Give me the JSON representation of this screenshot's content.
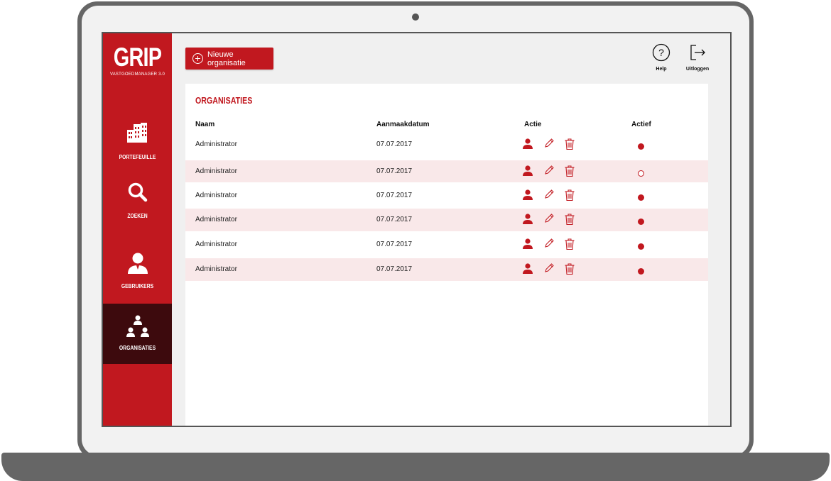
{
  "app": {
    "logo": "GRIP",
    "subtitle": "VASTGOEDMANAGER 3.0"
  },
  "sidebar": {
    "items": [
      {
        "label": "PORTEFEUILLE",
        "icon": "buildings-icon"
      },
      {
        "label": "ZOEKEN",
        "icon": "search-icon"
      },
      {
        "label": "GEBRUIKERS",
        "icon": "user-icon"
      },
      {
        "label": "ORGANISATIES",
        "icon": "organization-icon",
        "active": true
      }
    ]
  },
  "toolbar": {
    "new_label": "Nieuwe organisatie",
    "help_label": "Help",
    "logout_label": "Uitloggen"
  },
  "section_title": "ORGANISATIES",
  "table": {
    "headers": {
      "name": "Naam",
      "date": "Aanmaakdatum",
      "action": "Actie",
      "active": "Actief"
    },
    "rows": [
      {
        "name": "Administrator",
        "date": "07.07.2017",
        "active": true
      },
      {
        "name": "Administrator",
        "date": "07.07.2017",
        "active": false
      },
      {
        "name": "Administrator",
        "date": "07.07.2017",
        "active": true
      },
      {
        "name": "Administrator",
        "date": "07.07.2017",
        "active": true
      },
      {
        "name": "Administrator",
        "date": "07.07.2017",
        "active": true
      },
      {
        "name": "Administrator",
        "date": "07.07.2017",
        "active": true
      }
    ]
  },
  "colors": {
    "brand": "#c1181f",
    "active_nav": "#3d0a0d",
    "row_alt": "#f9e8e9"
  }
}
